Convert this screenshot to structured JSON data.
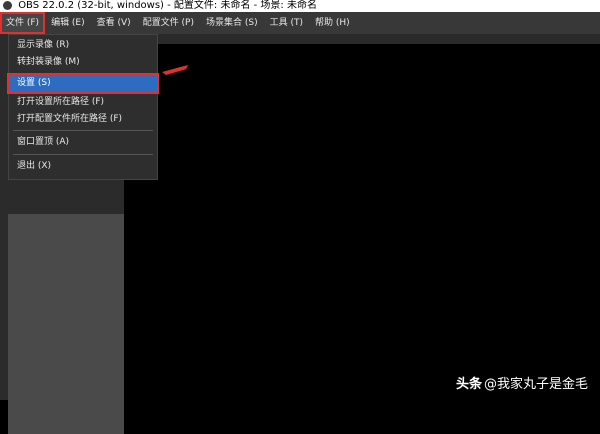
{
  "window": {
    "title": "OBS 22.0.2 (32-bit, windows) - 配置文件: 未命名 - 场景: 未命名"
  },
  "menubar": {
    "items": [
      {
        "label": "文件 (F)",
        "active": true
      },
      {
        "label": "编辑 (E)"
      },
      {
        "label": "查看 (V)"
      },
      {
        "label": "配置文件 (P)"
      },
      {
        "label": "场景集合 (S)"
      },
      {
        "label": "工具 (T)"
      },
      {
        "label": "帮助 (H)"
      }
    ]
  },
  "file_menu": {
    "items": [
      {
        "label": "显示录像 (R)"
      },
      {
        "label": "转封装录像 (M)"
      },
      {
        "label": "设置 (S)",
        "highlighted": true
      },
      {
        "label": "打开设置所在路径 (F)"
      },
      {
        "label": "打开配置文件所在路径 (F)"
      },
      {
        "label": "窗口置顶 (A)"
      },
      {
        "label": "退出 (X)"
      }
    ]
  },
  "watermark": {
    "brand": "头条",
    "handle": "@我家丸子是金毛"
  },
  "colors": {
    "highlight": "#2d6cc0",
    "annotation": "#e03030"
  }
}
